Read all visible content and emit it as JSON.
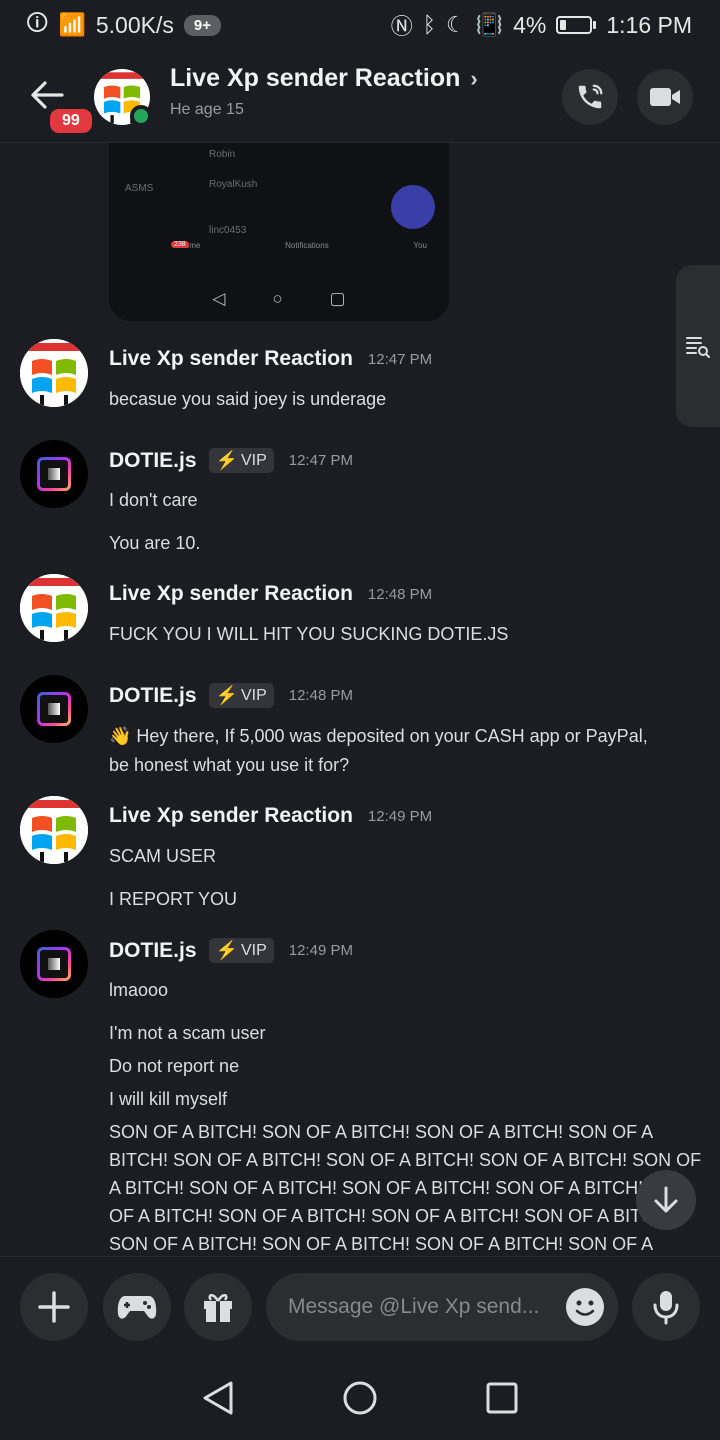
{
  "status_bar": {
    "speed": "5.00K/s",
    "notif_count": "9+",
    "battery": "4%",
    "time": "1:16 PM"
  },
  "header": {
    "unread_badge": "99",
    "title": "Live Xp sender Reaction",
    "subtitle": "He age 15"
  },
  "shared_screenshot": {
    "rows": [
      "Robin",
      "ASMS",
      "RoyalKush",
      "linc0453"
    ],
    "nav_labels": [
      "Home",
      "Notifications",
      "You"
    ],
    "home_badge": "238"
  },
  "messages": [
    {
      "author": "Live Xp sender Reaction",
      "time": "12:47 PM",
      "vip": false,
      "lines": [
        "becasue you said joey is underage"
      ]
    },
    {
      "author": "DOTIE.js",
      "time": "12:47 PM",
      "vip": true,
      "lines": [
        "I don't care",
        "You are 10."
      ]
    },
    {
      "author": "Live Xp sender Reaction",
      "time": "12:48 PM",
      "vip": false,
      "lines": [
        "FUCK YOU I WILL HIT YOU SUCKING DOTIE.JS"
      ]
    },
    {
      "author": "DOTIE.js",
      "time": "12:48 PM",
      "vip": true,
      "lines": [
        "👋 Hey there, If 5,000 was deposited on your CASH app or PayPal,",
        "be honest what you use it for?"
      ]
    },
    {
      "author": "Live Xp sender Reaction",
      "time": "12:49 PM",
      "vip": false,
      "lines": [
        "SCAM USER",
        "I REPORT YOU"
      ]
    },
    {
      "author": "DOTIE.js",
      "time": "12:49 PM",
      "vip": true,
      "lines": [
        "lmaooo",
        "I'm not a scam user",
        "Do not report ne",
        "I will kill myself",
        "SON OF A BITCH! SON OF A BITCH! SON OF A BITCH! SON OF A",
        "BITCH! SON OF A BITCH! SON OF A BITCH! SON OF A BITCH! SON OF",
        "A BITCH! SON OF A BITCH! SON OF A BITCH! SON OF A BITCH! SON",
        "OF A BITCH! SON OF A BITCH! SON OF A BITCH! SON OF A BITCH!",
        "SON OF A BITCH! SON OF A BITCH! SON OF A BITCH! SON OF A"
      ]
    }
  ],
  "vip_label": "VIP",
  "composer": {
    "placeholder": "Message @Live Xp send..."
  },
  "colors": {
    "background": "#1c1d22",
    "surface": "#2b2d31",
    "online": "#23a55a",
    "badge": "#e1393f",
    "vip_bolt": "#f0b232"
  }
}
